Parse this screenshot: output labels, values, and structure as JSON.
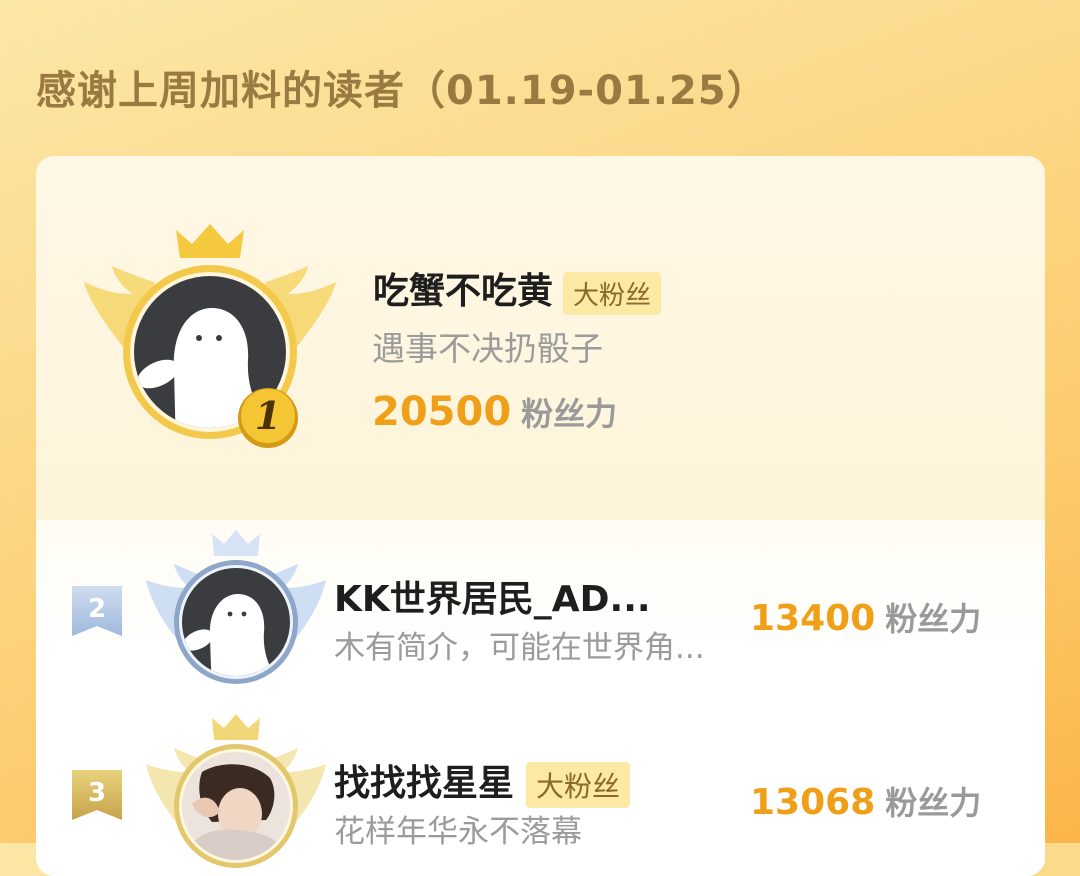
{
  "header": {
    "title": "感谢上周加料的读者（01.19-01.25）"
  },
  "top_reader": {
    "rank": "1",
    "name": "吃蟹不吃黄",
    "badge": "大粉丝",
    "bio": "遇事不决扔骰子",
    "score": "20500",
    "score_unit": "粉丝力"
  },
  "readers": [
    {
      "rank": "2",
      "name": "KK世界居民_AD...",
      "bio": "木有简介，可能在世界角...",
      "score": "13400",
      "score_unit": "粉丝力"
    },
    {
      "rank": "3",
      "name": "找找找星星",
      "badge": "大粉丝",
      "bio": "花样年华永不落幕",
      "score": "13068",
      "score_unit": "粉丝力"
    }
  ],
  "colors": {
    "score": "#f0a018",
    "gold": "#f2c233",
    "silver": "#a9c3e6",
    "bronze": "#e8cf77"
  }
}
